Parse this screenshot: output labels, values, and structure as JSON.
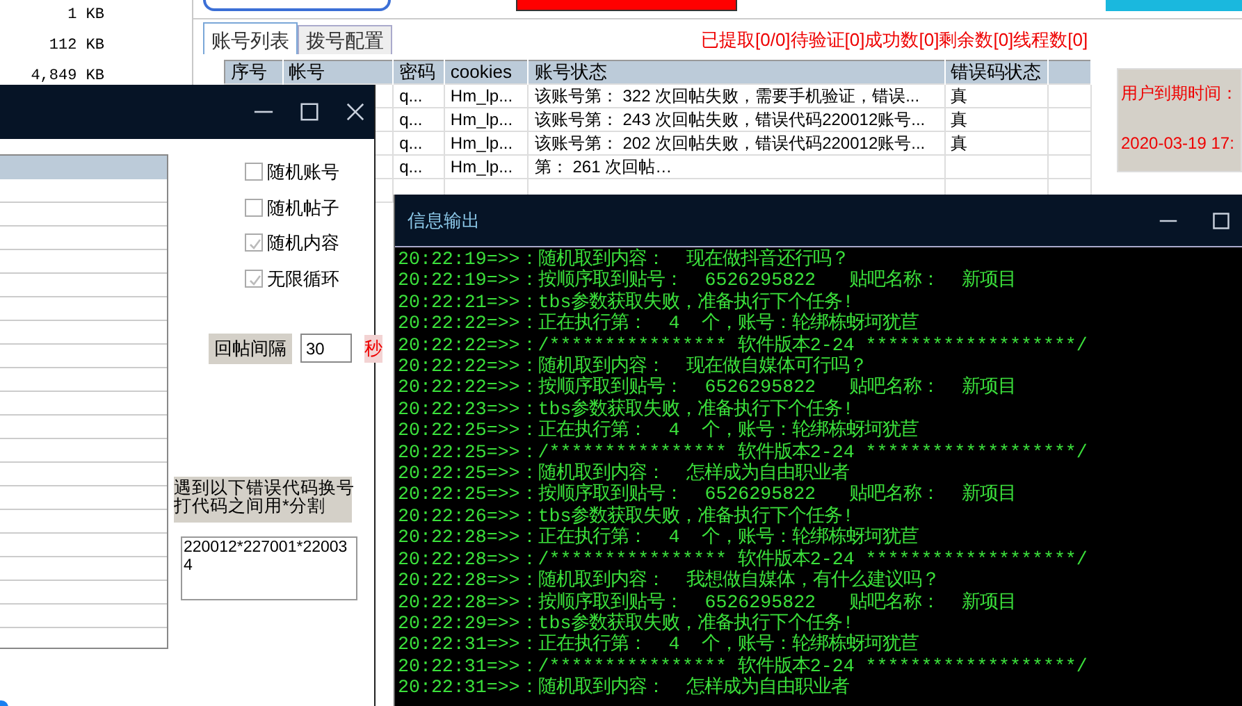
{
  "file_sizes": [
    "1 KB",
    "112 KB",
    "4,849 KB"
  ],
  "main": {
    "tabs": [
      {
        "label": "账号列表",
        "selected": true
      },
      {
        "label": "拨号配置",
        "selected": false
      }
    ],
    "status": "已提取[0/0]待验证[0]成功数[0]剩余数[0]线程数[0]",
    "table": {
      "columns": [
        "序号",
        "帐号",
        "密码",
        "cookies",
        "账号状态",
        "错误码状态"
      ],
      "rows": [
        {
          "password": "q...",
          "cookies": "Hm_lp...",
          "status": "该账号第： 322 次回帖失败，需要手机验证，错误...",
          "error_status": "真"
        },
        {
          "password": "q...",
          "cookies": "Hm_lp...",
          "status": "该账号第： 243 次回帖失败，错误代码220012账号...",
          "error_status": "真"
        },
        {
          "password": "q...",
          "cookies": "Hm_lp...",
          "status": "该账号第： 202 次回帖失败，错误代码220012账号...",
          "error_status": "真"
        },
        {
          "password": "q...",
          "cookies": "Hm_lp...",
          "status": "第： 261 次回帖…",
          "error_status": ""
        }
      ]
    },
    "expiry": {
      "label": "用户到期时间：",
      "value": "2020-03-19 17:"
    }
  },
  "settings_window": {
    "options": [
      {
        "label": "随机账号",
        "checked": false
      },
      {
        "label": "随机帖子",
        "checked": false
      },
      {
        "label": "随机内容",
        "checked": true
      },
      {
        "label": "无限循环",
        "checked": true
      }
    ],
    "interval": {
      "label": "回帖间隔",
      "value": "30",
      "unit": "秒"
    },
    "error_codes": {
      "hint": [
        "遇到以下错误代码换号",
        "打代码之间用*分割"
      ],
      "value": "220012*227001*220034"
    }
  },
  "log_window": {
    "title": "信息输出",
    "lines": [
      "20:22:19=>>：随机取到内容：  现在做抖音还行吗？",
      "20:22:19=>>：按顺序取到贴号：  6526295822   贴吧名称：  新项目",
      "20:22:21=>>：tbs参数获取失败，准备执行下个任务!",
      "20:22:22=>>：正在执行第：  4  个，账号：轮绑栋蚜坷犹苣",
      "20:22:22=>>：/**************** 软件版本2-24 *******************/",
      "20:22:22=>>：随机取到内容：  现在做自媒体可行吗？",
      "20:22:22=>>：按顺序取到贴号：  6526295822   贴吧名称：  新项目",
      "20:22:23=>>：tbs参数获取失败，准备执行下个任务!",
      "20:22:25=>>：正在执行第：  4  个，账号：轮绑栋蚜坷犹苣",
      "20:22:25=>>：/**************** 软件版本2-24 *******************/",
      "20:22:25=>>：随机取到内容：  怎样成为自由职业者",
      "20:22:25=>>：按顺序取到贴号：  6526295822   贴吧名称：  新项目",
      "20:22:26=>>：tbs参数获取失败，准备执行下个任务!",
      "20:22:28=>>：正在执行第：  4  个，账号：轮绑栋蚜坷犹苣",
      "20:22:28=>>：/**************** 软件版本2-24 *******************/",
      "20:22:28=>>：随机取到内容：  我想做自媒体，有什么建议吗？",
      "20:22:28=>>：按顺序取到贴号：  6526295822   贴吧名称：  新项目",
      "20:22:29=>>：tbs参数获取失败，准备执行下个任务!",
      "20:22:31=>>：正在执行第：  4  个，账号：轮绑栋蚜坷犹苣",
      "20:22:31=>>：/**************** 软件版本2-24 *******************/",
      "20:22:31=>>：随机取到内容：  怎样成为自由职业者"
    ]
  }
}
